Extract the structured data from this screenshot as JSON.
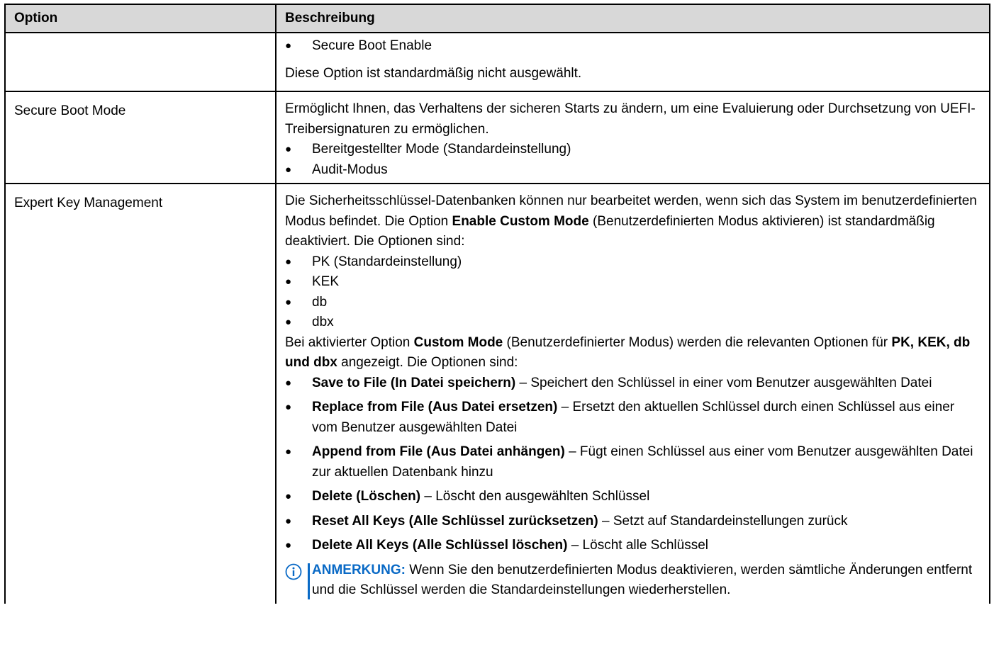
{
  "table": {
    "headers": {
      "option": "Option",
      "description": "Beschreibung"
    },
    "row1": {
      "option": "",
      "bullet": "Secure Boot Enable",
      "text": "Diese Option ist standardmäßig nicht ausgewählt."
    },
    "row2": {
      "option": "Secure Boot Mode",
      "text": "Ermöglicht Ihnen, das Verhaltens der sicheren Starts zu ändern, um eine Evaluierung oder Durchsetzung von UEFI-Treibersignaturen zu ermöglichen.",
      "bullets": [
        "Bereitgestellter Mode (Standardeinstellung)",
        "Audit-Modus"
      ]
    },
    "row3": {
      "option": "Expert Key Management",
      "intro": {
        "pre": "Die Sicherheitsschlüssel-Datenbanken können nur bearbeitet werden, wenn sich das System im benutzerdefinierten Modus befindet. Die Option ",
        "bold": "Enable Custom Mode",
        "post": " (Benutzerdefinierten Modus aktivieren) ist standardmäßig deaktiviert. Die Optionen sind:"
      },
      "keys": [
        "PK (Standardeinstellung)",
        "KEK",
        "db",
        "dbx"
      ],
      "custom": {
        "pre": "Bei aktivierter Option ",
        "bold1": "Custom Mode",
        "mid": " (Benutzerdefinierter Modus) werden die relevanten Optionen für ",
        "bold2": "PK, KEK, db und dbx",
        "post": " angezeigt. Die Optionen sind:"
      },
      "actions": [
        {
          "bold": "Save to File (In Datei speichern)",
          "text": " – Speichert den Schlüssel in einer vom Benutzer ausgewählten Datei"
        },
        {
          "bold": "Replace from File (Aus Datei ersetzen)",
          "text": " – Ersetzt den aktuellen Schlüssel durch einen Schlüssel aus einer vom Benutzer ausgewählten Datei"
        },
        {
          "bold": "Append from File (Aus Datei anhängen)",
          "text": " – Fügt einen Schlüssel aus einer vom Benutzer ausgewählten Datei zur aktuellen Datenbank hinzu"
        },
        {
          "bold": "Delete (Löschen)",
          "text": " – Löscht den ausgewählten Schlüssel"
        },
        {
          "bold": "Reset All Keys (Alle Schlüssel zurücksetzen)",
          "text": " – Setzt auf Standardeinstellungen zurück"
        },
        {
          "bold": "Delete All Keys (Alle Schlüssel löschen)",
          "text": " – Löscht alle Schlüssel"
        }
      ],
      "note": {
        "label": "ANMERKUNG:",
        "text": " Wenn Sie den benutzerdefinierten Modus deaktivieren, werden sämtliche Änderungen entfernt und die Schlüssel werden die Standardeinstellungen wiederherstellen."
      }
    },
    "bullet_char": "●",
    "colors": {
      "header_bg": "#d8d8d8",
      "note_accent": "#0a6ac6",
      "border": "#000000"
    }
  }
}
